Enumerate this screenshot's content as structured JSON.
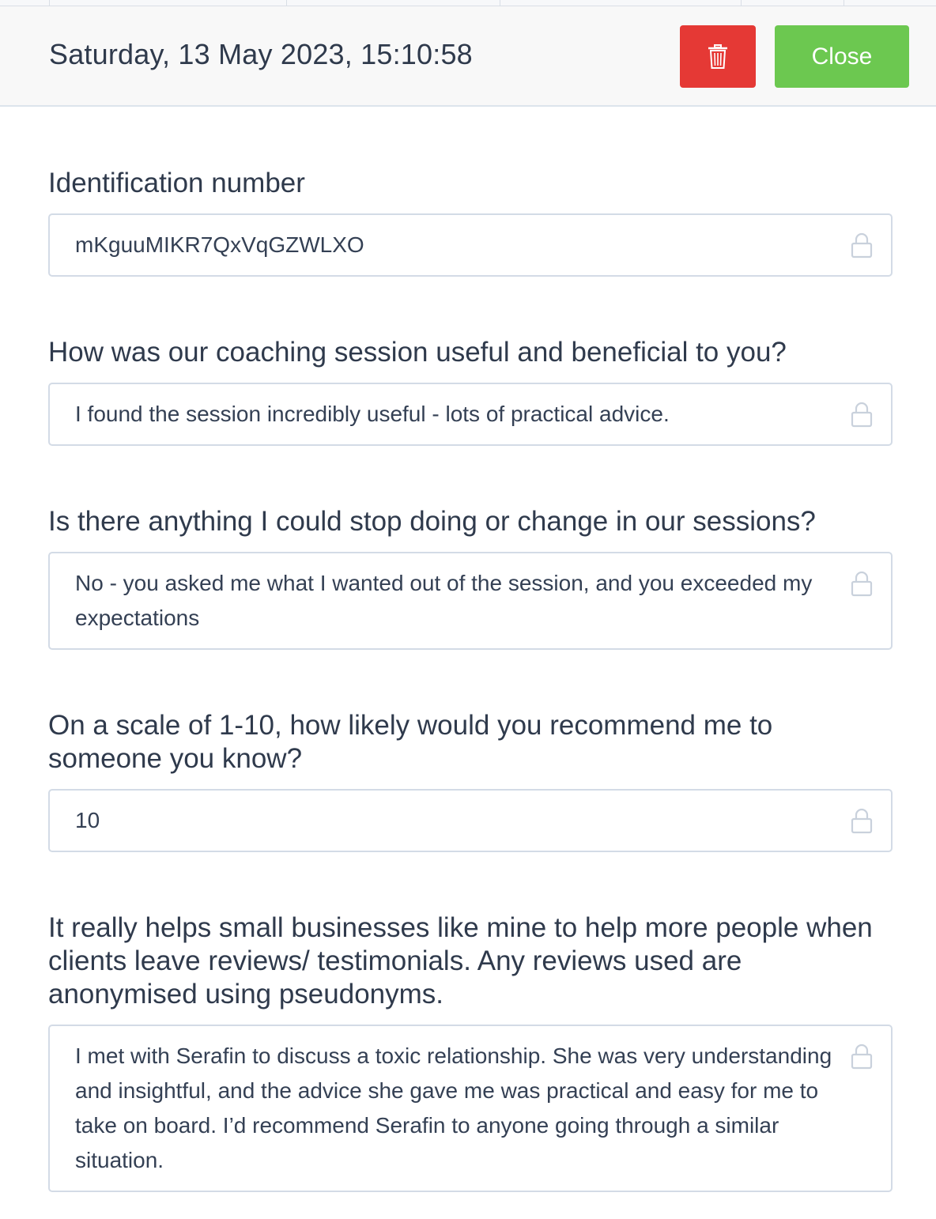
{
  "header": {
    "datetime": "Saturday, 13 May 2023, 15:10:58",
    "close_label": "Close",
    "delete_icon": "trash-icon"
  },
  "fields": [
    {
      "label": "Identification number",
      "value": "mKguuMIKR7QxVqGZWLXO",
      "icon": "lock-icon"
    },
    {
      "label": "How was our coaching session useful and beneficial to you?",
      "value": "I found the session incredibly useful - lots of practical advice.",
      "icon": "lock-icon"
    },
    {
      "label": "Is there anything I could stop doing or change in our sessions?",
      "value": "No - you asked me what I wanted out of the session, and you exceeded my expectations",
      "icon": "lock-icon"
    },
    {
      "label": "On a scale of 1-10, how likely would you recommend me to someone you know?",
      "value": "10",
      "icon": "lock-icon"
    },
    {
      "label": "It really helps small businesses like mine to help more people when clients leave reviews/ testimonials. Any reviews used are anonymised using pseudonyms.",
      "value": "I met with Serafin to discuss a toxic relationship. She was very understanding and insightful, and the advice she gave me was practical and easy for me to take on board. I’d recommend Serafin to anyone going through a similar situation.",
      "icon": "lock-icon"
    }
  ],
  "colors": {
    "delete": "#e53935",
    "close": "#6cc850",
    "border": "#d3dbe6",
    "text": "#2f3a4c"
  }
}
